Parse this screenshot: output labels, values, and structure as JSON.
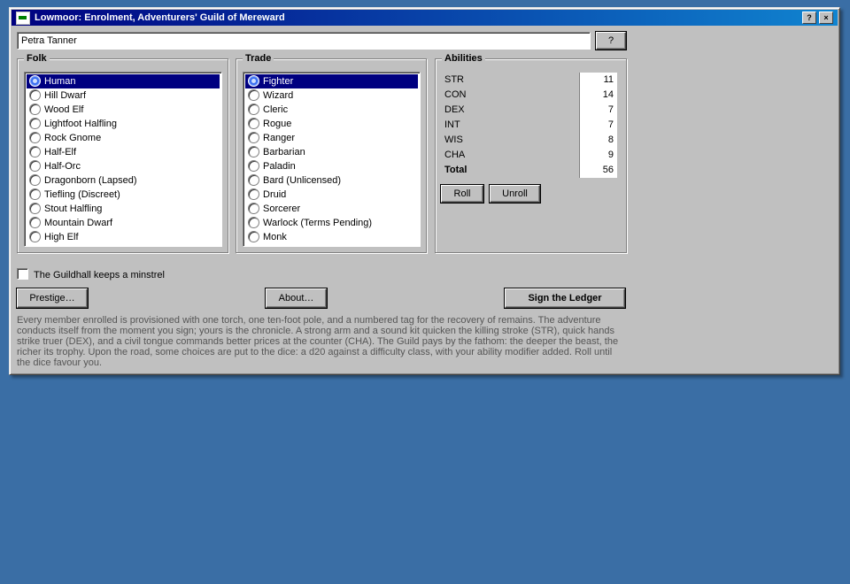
{
  "window": {
    "title": "Lowmoor: Enrolment, Adventurers' Guild of Mereward",
    "help_label": "?",
    "close_label": "×"
  },
  "name_input": {
    "value": "Petra Tanner"
  },
  "help_button": {
    "label": "?"
  },
  "folk": {
    "label": "Folk",
    "items": [
      "Human",
      "Hill Dwarf",
      "Wood Elf",
      "Lightfoot Halfling",
      "Rock Gnome",
      "Half-Elf",
      "Half-Orc",
      "Dragonborn (Lapsed)",
      "Tiefling (Discreet)",
      "Stout Halfling",
      "Mountain Dwarf",
      "High Elf"
    ],
    "selected": "Human"
  },
  "trade": {
    "label": "Trade",
    "items": [
      "Fighter",
      "Wizard",
      "Cleric",
      "Rogue",
      "Ranger",
      "Barbarian",
      "Paladin",
      "Bard (Unlicensed)",
      "Druid",
      "Sorcerer",
      "Warlock (Terms Pending)",
      "Monk"
    ],
    "selected": "Fighter"
  },
  "abilities": {
    "label": "Abilities",
    "rows": [
      {
        "name": "STR",
        "value": "11"
      },
      {
        "name": "CON",
        "value": "14"
      },
      {
        "name": "DEX",
        "value": "7"
      },
      {
        "name": "INT",
        "value": "7"
      },
      {
        "name": "WIS",
        "value": "8"
      },
      {
        "name": "CHA",
        "value": "9"
      },
      {
        "name": "Total",
        "value": "56"
      }
    ],
    "roll_label": "Roll",
    "unroll_label": "Unroll"
  },
  "minstrel_checkbox": {
    "label": "The Guildhall keeps a minstrel",
    "checked": false
  },
  "buttons": {
    "prestige": "Prestige…",
    "about": "About…",
    "sign": "Sign the Ledger"
  },
  "footnote": "Every member enrolled is provisioned with one torch, one ten-foot pole, and a numbered tag for the recovery of remains. The adventure conducts itself from the moment you sign; yours is the chronicle. A strong arm and a sound kit quicken the killing stroke (STR), quick hands strike truer (DEX), and a civil tongue commands better prices at the counter (CHA). The Guild pays by the fathom: the deeper the beast, the richer its trophy. Upon the road, some choices are put to the dice: a d20 against a difficulty class, with your ability modifier added. Roll until the dice favour you.",
  "colors": {
    "desktop": "#3a6ea5",
    "selection": "#000080",
    "titlebar_start": "#000080",
    "titlebar_end": "#1084d0"
  }
}
